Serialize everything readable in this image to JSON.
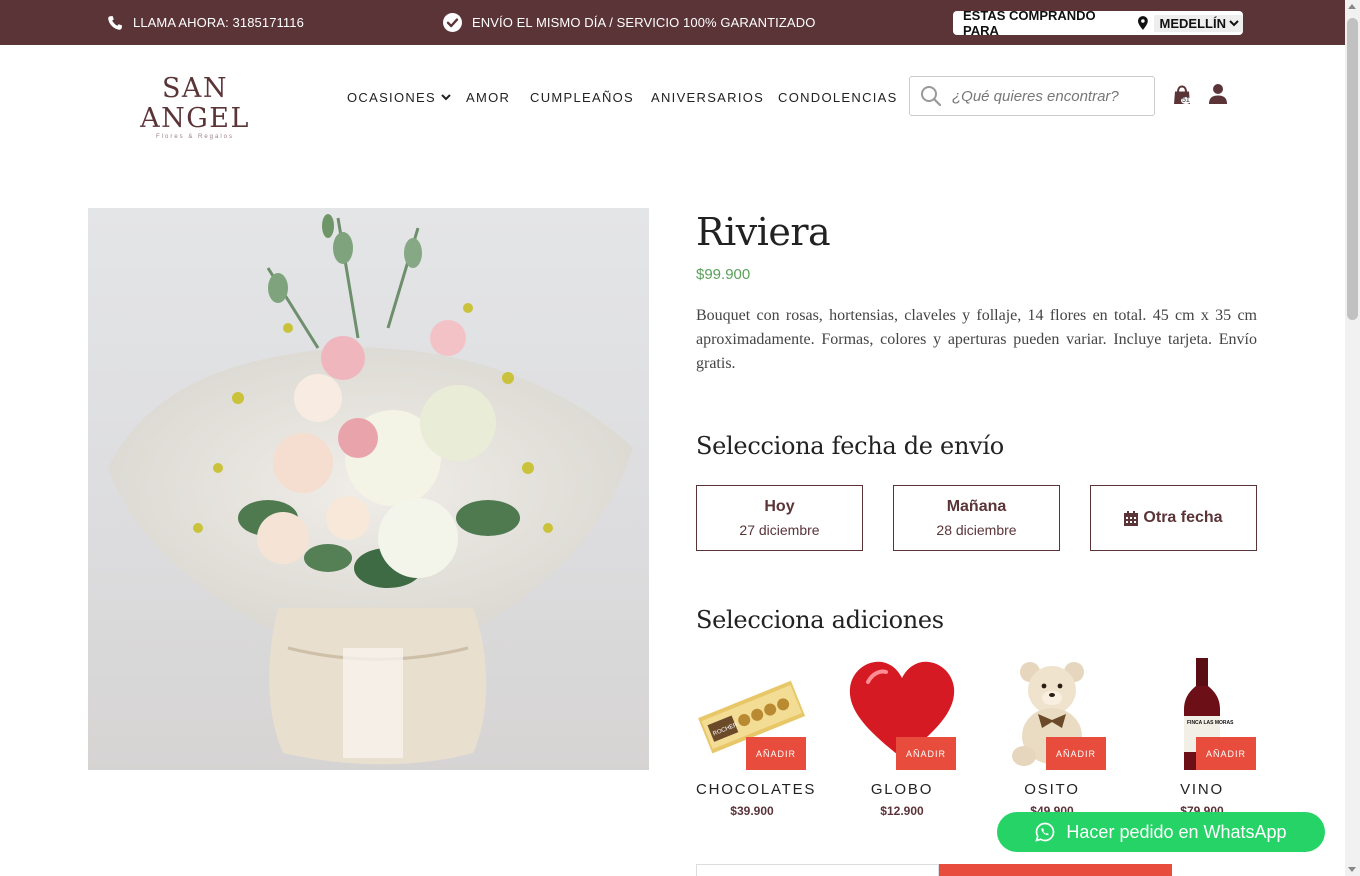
{
  "topbar": {
    "phone_text": "LLAMA AHORA: 3185171116",
    "shipping_text": "ENVÍO EL MISMO DÍA / SERVICIO 100% GARANTIZADO",
    "buying_for_label": "ESTAS COMPRANDO PARA",
    "city": "MEDELLÍN",
    "background_color": "#5b3438"
  },
  "header": {
    "logo_main": "SAN ANGEL",
    "logo_sub": "Flores & Regalos",
    "nav": {
      "ocasiones": "OCASIONES",
      "amor": "AMOR",
      "cumpleanos": "CUMPLEAÑOS",
      "aniversarios": "ANIVERSARIOS",
      "condolencias": "CONDOLENCIAS"
    },
    "search_placeholder": "¿Qué quieres encontrar?",
    "cart_count": "51"
  },
  "product": {
    "title": "Riviera",
    "price": "$99.900",
    "description": "Bouquet con rosas, hortensias, claveles y follaje, 14 flores en total. 45  cm x 35 cm aproximadamente. Formas, colores y aperturas pueden variar. Incluye tarjeta. Envío gratis.",
    "price_color": "#5aa05a"
  },
  "delivery": {
    "title": "Selecciona fecha de envío",
    "today_label": "Hoy",
    "today_date": "27 diciembre",
    "tomorrow_label": "Mañana",
    "tomorrow_date": "28 diciembre",
    "other_label": "Otra fecha"
  },
  "addons": {
    "title": "Selecciona adiciones",
    "add_label": "AÑADIR",
    "items": [
      {
        "name": "CHOCOLATES",
        "price": "$39.900"
      },
      {
        "name": "GLOBO",
        "price": "$12.900"
      },
      {
        "name": "OSITO",
        "price": "$49.900"
      },
      {
        "name": "VINO",
        "price": "$79.900"
      }
    ],
    "wine_label": "FINCA LAS MORAS"
  },
  "chocolate_brand": "ROCHER",
  "whatsapp": {
    "label": "Hacer pedido en WhatsApp",
    "color": "#25d366"
  },
  "accent_color": "#e74c3c"
}
